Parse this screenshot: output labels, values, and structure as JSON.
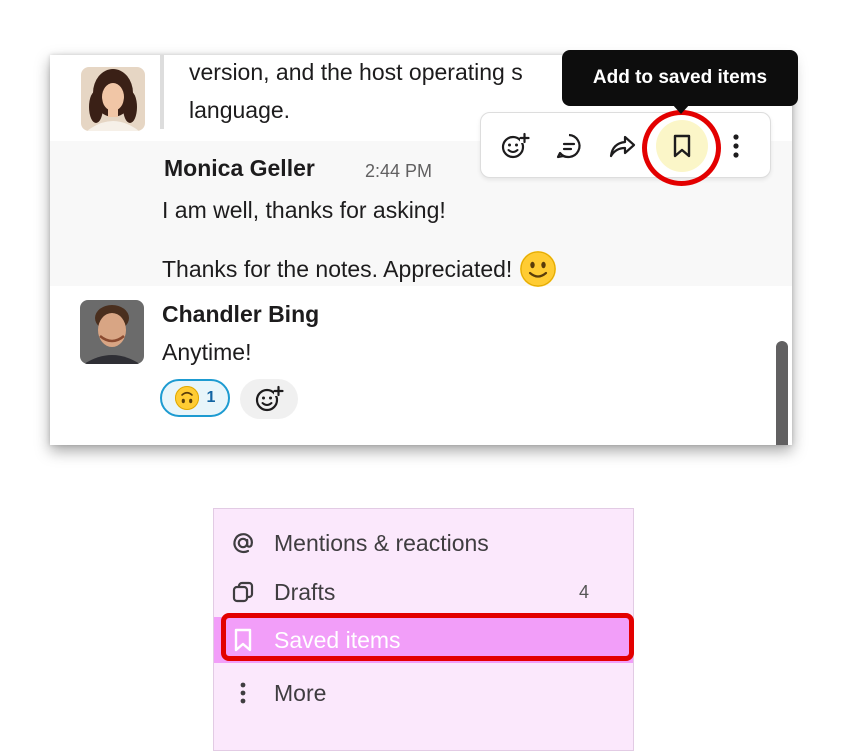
{
  "tooltip": {
    "text": "Add to saved items"
  },
  "chat": {
    "quoted_lines": [
      "version, and the host operating s",
      "language."
    ],
    "messages": [
      {
        "author": "Monica Geller",
        "time": "2:44 PM",
        "lines": [
          "I am well, thanks for asking!",
          "Thanks for the notes. Appreciated!"
        ],
        "emoji": "slightly-smiling-face"
      },
      {
        "author": "Chandler Bing",
        "lines": [
          "Anytime!"
        ],
        "reaction": {
          "emoji": "upside-down-face",
          "count": "1"
        }
      }
    ]
  },
  "toolbar": {
    "buttons": [
      {
        "name": "add-reaction",
        "icon": "emoji-add-icon"
      },
      {
        "name": "reply-in-thread",
        "icon": "thread-icon"
      },
      {
        "name": "forward",
        "icon": "forward-icon"
      },
      {
        "name": "save",
        "icon": "bookmark-icon"
      },
      {
        "name": "more-actions",
        "icon": "vertical-ellipsis-icon"
      }
    ]
  },
  "sidebar": {
    "items": [
      {
        "label": "Mentions & reactions",
        "icon": "at-icon"
      },
      {
        "label": "Drafts",
        "icon": "drafts-icon",
        "count": "4"
      },
      {
        "label": "Saved items",
        "icon": "bookmark-icon",
        "active": true
      },
      {
        "label": "More",
        "icon": "vertical-ellipsis-icon"
      }
    ]
  },
  "colors": {
    "highlight_red": "#e30000",
    "sidebar_bg": "#fbe8fc",
    "sidebar_active": "#f29ef9",
    "reaction_border": "#1d9bd1",
    "save_button_bg": "#fbf6c8"
  }
}
